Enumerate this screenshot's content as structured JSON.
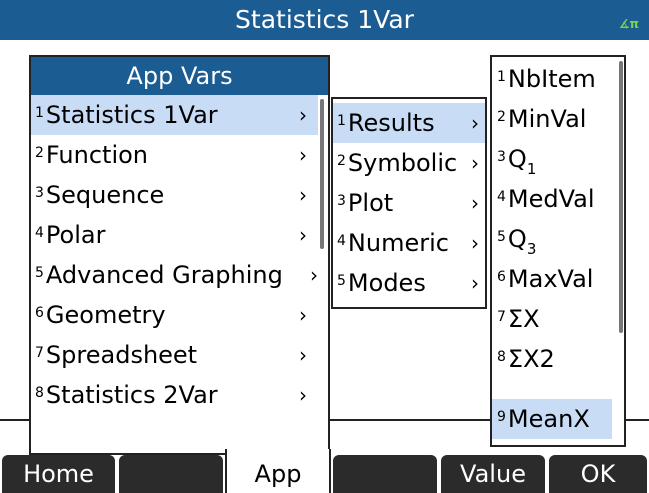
{
  "header": {
    "title": "Statistics 1Var",
    "angle_mode": "∡π"
  },
  "menu1": {
    "title": "App Vars",
    "items": [
      {
        "num": "1",
        "label": "Statistics 1Var",
        "arrow": "›"
      },
      {
        "num": "2",
        "label": "Function",
        "arrow": "›"
      },
      {
        "num": "3",
        "label": "Sequence",
        "arrow": "›"
      },
      {
        "num": "4",
        "label": "Polar",
        "arrow": "›"
      },
      {
        "num": "5",
        "label": "Advanced Graphing",
        "arrow": "›"
      },
      {
        "num": "6",
        "label": "Geometry",
        "arrow": "›"
      },
      {
        "num": "7",
        "label": "Spreadsheet",
        "arrow": "›"
      },
      {
        "num": "8",
        "label": "Statistics 2Var",
        "arrow": "›"
      }
    ]
  },
  "menu2": {
    "items": [
      {
        "num": "1",
        "label": "Results",
        "arrow": "›"
      },
      {
        "num": "2",
        "label": "Symbolic",
        "arrow": "›"
      },
      {
        "num": "3",
        "label": "Plot",
        "arrow": "›"
      },
      {
        "num": "4",
        "label": "Numeric",
        "arrow": "›"
      },
      {
        "num": "5",
        "label": "Modes",
        "arrow": "›"
      }
    ]
  },
  "menu3": {
    "items": [
      {
        "num": "1",
        "label": "NbItem"
      },
      {
        "num": "2",
        "label": "MinVal"
      },
      {
        "num": "3",
        "label": "Q",
        "sub": "1"
      },
      {
        "num": "4",
        "label": "MedVal"
      },
      {
        "num": "5",
        "label": "Q",
        "sub": "3"
      },
      {
        "num": "6",
        "label": "MaxVal"
      },
      {
        "num": "7",
        "label": "ΣX"
      },
      {
        "num": "8",
        "label": "ΣX2"
      },
      {
        "num": "9",
        "label": "MeanX"
      }
    ]
  },
  "softkeys": {
    "home": "Home",
    "app": "App",
    "value": "Value",
    "ok": "OK"
  }
}
